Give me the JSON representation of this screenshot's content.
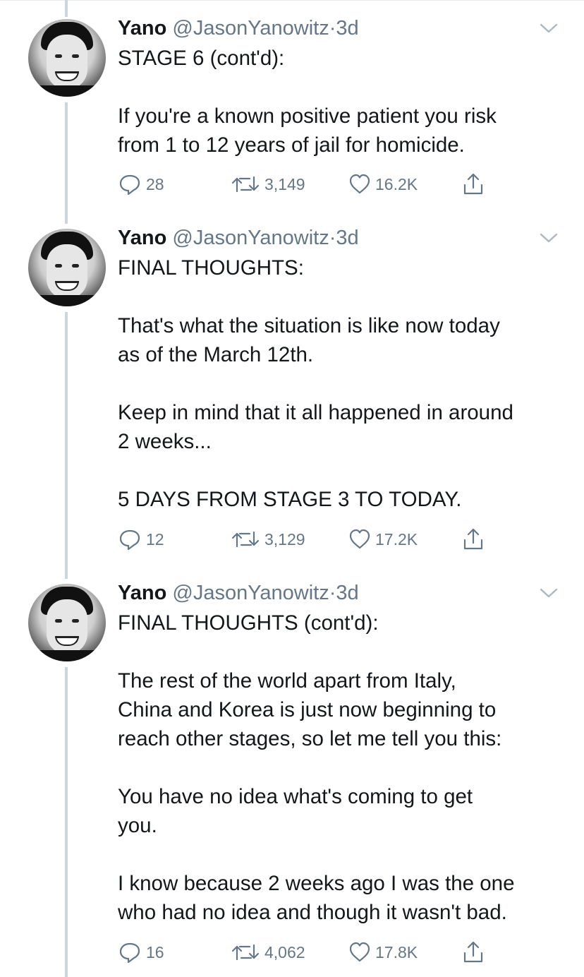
{
  "tweets": [
    {
      "name": "Yano",
      "handle": "@JasonYanowitz",
      "dot": "·",
      "time": "3d",
      "lines": [
        "STAGE 6 (cont'd):",
        "",
        "If you're a known positive patient you risk",
        "from 1 to 12 years of jail for homicide."
      ],
      "replies": "28",
      "retweets": "3,149",
      "likes": "16.2K"
    },
    {
      "name": "Yano",
      "handle": "@JasonYanowitz",
      "dot": "·",
      "time": "3d",
      "lines": [
        "FINAL THOUGHTS:",
        "",
        "That's what the situation is like now today",
        "as of the March 12th.",
        "",
        "Keep in mind that it all happened in around",
        "2 weeks...",
        "",
        "5 DAYS FROM STAGE 3 TO TODAY."
      ],
      "replies": "12",
      "retweets": "3,129",
      "likes": "17.2K"
    },
    {
      "name": "Yano",
      "handle": "@JasonYanowitz",
      "dot": "·",
      "time": "3d",
      "lines": [
        "FINAL THOUGHTS (cont'd):",
        "",
        "The rest of the world apart from Italy,",
        "China and Korea is just now beginning to",
        "reach other stages, so let me tell you this:",
        "",
        "You have no idea what's coming to get",
        "you.",
        "",
        "I know because 2 weeks ago I was the one",
        "who had no idea and though it wasn't bad."
      ],
      "replies": "16",
      "retweets": "4,062",
      "likes": "17.8K"
    }
  ],
  "colors": {
    "text": "#14171a",
    "muted": "#657786",
    "thread_line": "#ccd6dd"
  }
}
